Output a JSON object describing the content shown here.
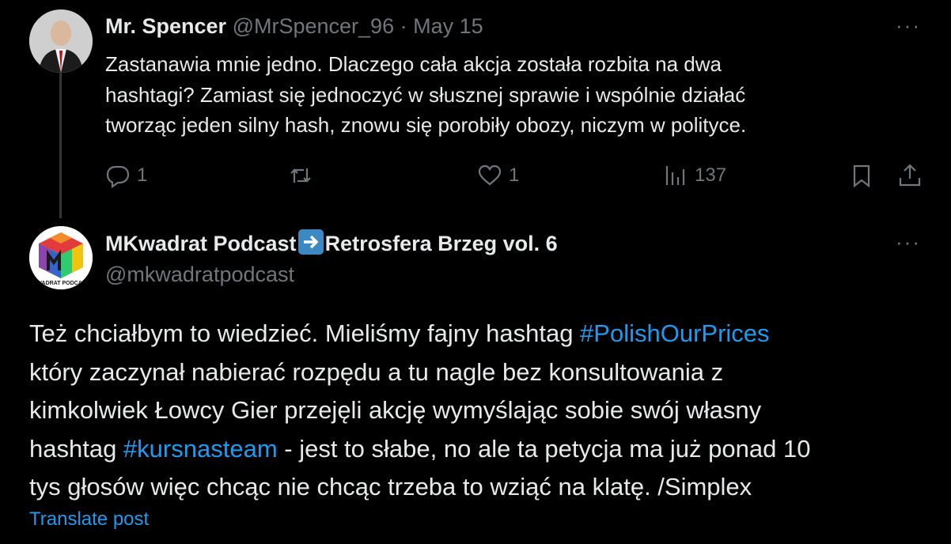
{
  "reply": {
    "author_name": "Mr. Spencer",
    "author_handle": "@MrSpencer_96",
    "separator": "·",
    "date": "May 15",
    "text_lines": [
      "Zastanawia mnie jedno. Dlaczego cała akcja została rozbita na dwa",
      "hashtagi? Zamiast się jednoczyć w słusznej sprawie i wspólnie działać",
      "tworząc jeden silny hash, znowu się porobiły obozy, niczym w polityce."
    ],
    "replies_count": "1",
    "likes_count": "1",
    "views_count": "137",
    "more_label": "···"
  },
  "main": {
    "author_name_part1": "MKwadrat Podcast",
    "author_name_part2": "Retrosfera Brzeg vol. 6",
    "author_handle": "@mkwadratpodcast",
    "more_label": "···",
    "body": {
      "l1_text": "Też chciałbym to wiedzieć. Mieliśmy fajny hashtag ",
      "hashtag1": "#PolishOurPrices",
      "l2": "który zaczynał nabierać rozpędu a tu nagle bez konsultowania z",
      "l3": "kimkolwiek Łowcy Gier przejęli akcję wymyślając sobie swój własny",
      "l4_pre": "hashtag ",
      "hashtag2": "#kursnasteam",
      "l4_post": " - jest to słabe, no ale ta petycja ma już ponad 10",
      "l5": "tys głosów więc chcąc nie chcąc trzeba to wziąć na klatę. /Simplex"
    },
    "avatar_text": "KWADRAT PODCAST",
    "translate_label": "Translate post"
  },
  "colors": {
    "background": "#000000",
    "text": "#e7e9ea",
    "secondary": "#71767b",
    "link": "#1d9bf0"
  }
}
